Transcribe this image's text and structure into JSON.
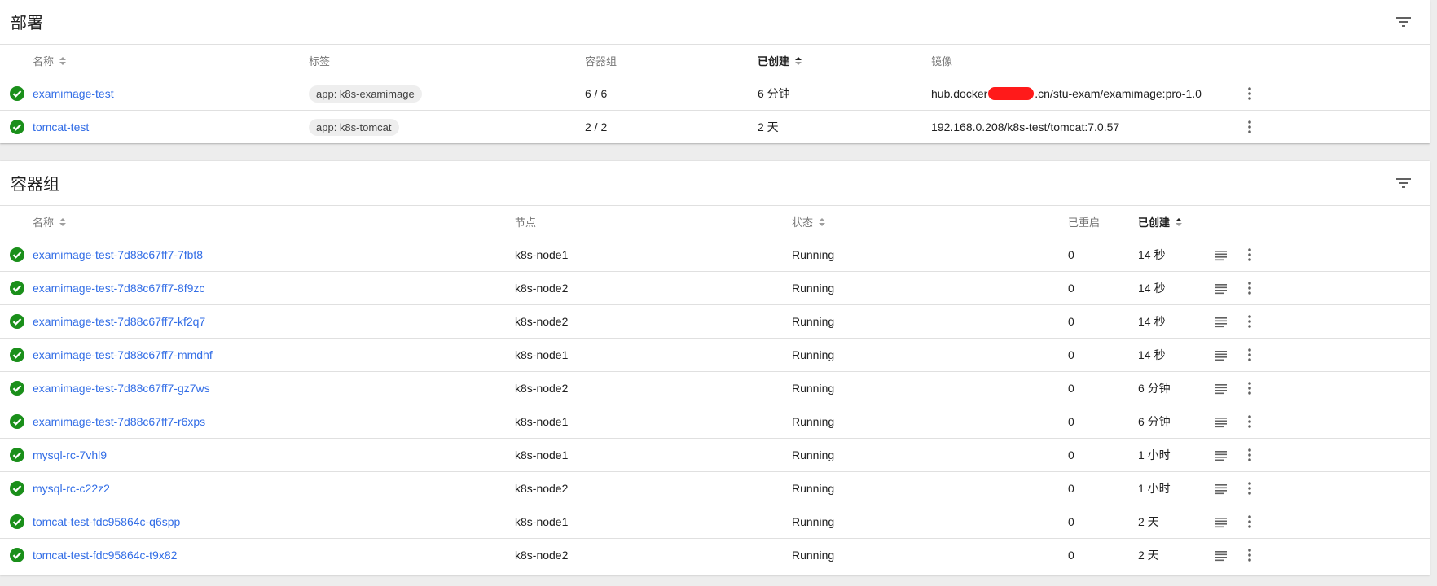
{
  "deployments": {
    "title": "部署",
    "columns": {
      "name": "名称",
      "labels": "标签",
      "pods": "容器组",
      "created": "已创建",
      "images": "镜像"
    },
    "rows": [
      {
        "name": "examimage-test",
        "label": "app: k8s-examimage",
        "pods": "6 / 6",
        "created": "6 分钟",
        "image_prefix": "hub.docker",
        "image_suffix": ".cn/stu-exam/examimage:pro-1.0"
      },
      {
        "name": "tomcat-test",
        "label": "app: k8s-tomcat",
        "pods": "2 / 2",
        "created": "2 天",
        "image_prefix": "192.168.0.208/k8s-test/tomcat:7.0.57",
        "image_suffix": ""
      }
    ]
  },
  "pods": {
    "title": "容器组",
    "columns": {
      "name": "名称",
      "node": "节点",
      "status": "状态",
      "restarts": "已重启",
      "created": "已创建"
    },
    "rows": [
      {
        "name": "examimage-test-7d88c67ff7-7fbt8",
        "node": "k8s-node1",
        "status": "Running",
        "restarts": "0",
        "created": "14 秒"
      },
      {
        "name": "examimage-test-7d88c67ff7-8f9zc",
        "node": "k8s-node2",
        "status": "Running",
        "restarts": "0",
        "created": "14 秒"
      },
      {
        "name": "examimage-test-7d88c67ff7-kf2q7",
        "node": "k8s-node2",
        "status": "Running",
        "restarts": "0",
        "created": "14 秒"
      },
      {
        "name": "examimage-test-7d88c67ff7-mmdhf",
        "node": "k8s-node1",
        "status": "Running",
        "restarts": "0",
        "created": "14 秒"
      },
      {
        "name": "examimage-test-7d88c67ff7-gz7ws",
        "node": "k8s-node2",
        "status": "Running",
        "restarts": "0",
        "created": "6 分钟"
      },
      {
        "name": "examimage-test-7d88c67ff7-r6xps",
        "node": "k8s-node1",
        "status": "Running",
        "restarts": "0",
        "created": "6 分钟"
      },
      {
        "name": "mysql-rc-7vhl9",
        "node": "k8s-node1",
        "status": "Running",
        "restarts": "0",
        "created": "1 小时"
      },
      {
        "name": "mysql-rc-c22z2",
        "node": "k8s-node2",
        "status": "Running",
        "restarts": "0",
        "created": "1 小时"
      },
      {
        "name": "tomcat-test-fdc95864c-q6spp",
        "node": "k8s-node1",
        "status": "Running",
        "restarts": "0",
        "created": "2 天"
      },
      {
        "name": "tomcat-test-fdc95864c-t9x82",
        "node": "k8s-node2",
        "status": "Running",
        "restarts": "0",
        "created": "2 天"
      }
    ]
  },
  "colors": {
    "link": "#326de6",
    "success": "#1a8f1a",
    "redaction": "#ff1a1a"
  },
  "icons": {
    "status": "check-circle-icon",
    "filter": "filter-icon",
    "menu": "more-vert-icon",
    "logs": "logs-icon",
    "sort": "sort-icon"
  }
}
